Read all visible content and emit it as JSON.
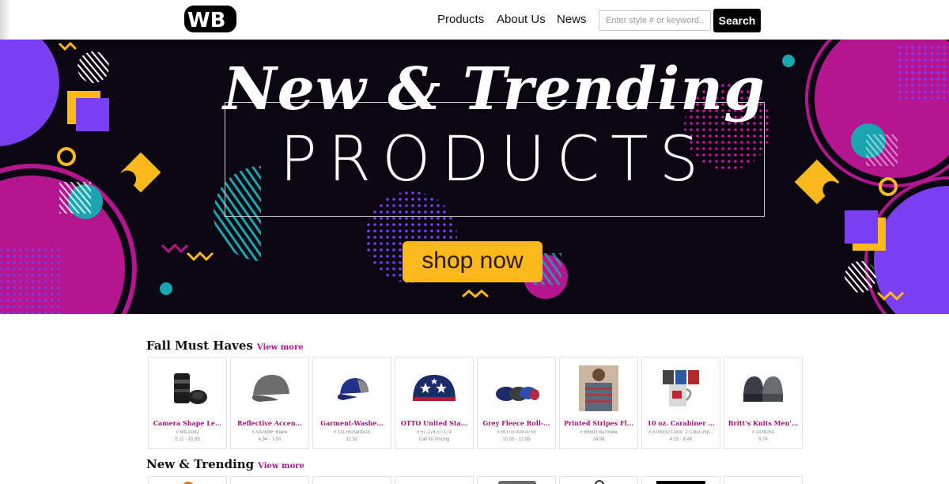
{
  "header": {
    "logo_text": "WB",
    "nav": [
      "Products",
      "About Us",
      "News"
    ],
    "search_placeholder": "Enter style # or keyword...",
    "search_button": "Search"
  },
  "banner": {
    "script_title": "New & Trending",
    "products_title": "PRODUCTS",
    "cta": "shop now",
    "colors": {
      "magenta": "#b5168f",
      "purple": "#7b3ff2",
      "yellow": "#fbb91c",
      "teal": "#1aa6b0",
      "background": "#0b0712"
    }
  },
  "sections": [
    {
      "title": "Fall Must Haves",
      "view_more": "View more",
      "products": [
        {
          "name": "Camera Shape Le...",
          "sku": "# MILA042",
          "price": "5.11 - 10.85",
          "icon": "camera-lens-mug-icon"
        },
        {
          "name": "Reflective Accen...",
          "sku": "# AA-888F Blank",
          "price": "4.94 - 7.50",
          "icon": "gray-cap-icon"
        },
        {
          "name": "Garment-Washe...",
          "sku": "# 111 Richardson",
          "price": "11.52",
          "icon": "blue-trucker-cap-icon"
        },
        {
          "name": "OTTO United Sta...",
          "sku": "# 57-174,57-174",
          "price": "Call for Pricing",
          "icon": "stars-flag-cap-icon"
        },
        {
          "name": "Grey Fleece Roll-...",
          "sku": "# RUTB-009-4753",
          "price": "10.55 - 12.95",
          "icon": "duffel-bags-icon"
        },
        {
          "name": "Printed Stripes Fl...",
          "sku": "# B8603 Burnside",
          "price": "24.98",
          "icon": "striped-flannel-shirt-icon"
        },
        {
          "name": "10 oz. Carabiner ...",
          "sku": "# ATM332 Color: 2 Color imp...",
          "price": "4.29 - 8.46",
          "icon": "carabiner-mugs-icon"
        },
        {
          "name": "Britt's Knits Men'...",
          "sku": "# 2338263",
          "price": "9.74",
          "icon": "knit-beanies-icon"
        }
      ]
    },
    {
      "title": "New & Trending",
      "view_more": "View more"
    }
  ]
}
